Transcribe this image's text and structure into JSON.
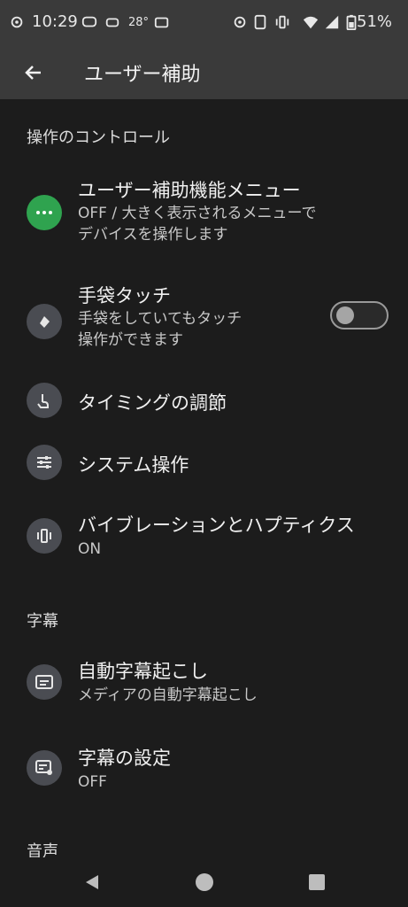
{
  "status_bar": {
    "time": "10:29",
    "temperature": "28°",
    "battery": "51%"
  },
  "app_bar": {
    "title": "ユーザー補助"
  },
  "sections": {
    "controls": "操作のコントロール",
    "captions": "字幕",
    "audio": "音声"
  },
  "items": {
    "menu": {
      "title": "ユーザー補助機能メニュー",
      "summary_line1": "OFF / 大きく表示されるメニューで",
      "summary_line2": "デバイスを操作します"
    },
    "glove": {
      "title": "手袋タッチ",
      "summary_line1": "手袋をしていてもタッチ",
      "summary_line2": "操作ができます",
      "toggle_on": false
    },
    "timing": {
      "title": "タイミングの調節"
    },
    "system": {
      "title": "システム操作"
    },
    "vibration": {
      "title": "バイブレーションとハプティクス",
      "summary": "ON"
    },
    "live_caption": {
      "title": "自動字幕起こし",
      "summary": "メディアの自動字幕起こし"
    },
    "caption_settings": {
      "title": "字幕の設定",
      "summary": "OFF"
    }
  },
  "colors": {
    "accent_green": "#2fa34f",
    "background": "#1c1c1c",
    "bar": "#3a3a3a"
  }
}
